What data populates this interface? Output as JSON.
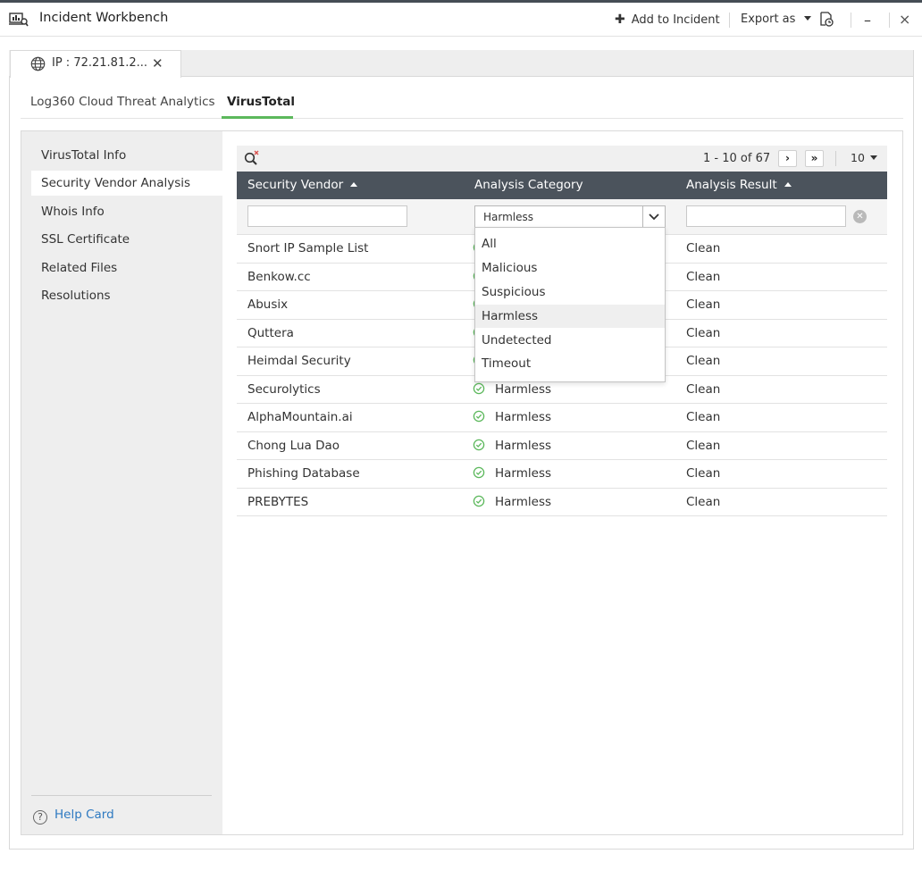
{
  "window": {
    "title": "Incident Workbench",
    "add_to_incident": "Add to Incident",
    "export_as": "Export as"
  },
  "tabs": {
    "ip_tab_label": "IP : 72.21.81.2..."
  },
  "subtabs": [
    "Log360 Cloud Threat Analytics",
    "VirusTotal"
  ],
  "sidebar": {
    "items": [
      "VirusTotal Info",
      "Security Vendor Analysis",
      "Whois Info",
      "SSL Certificate",
      "Related Files",
      "Resolutions"
    ],
    "active": "Security Vendor Analysis",
    "help_label": "Help Card"
  },
  "pagination": {
    "range_text": "1 - 10 of 67",
    "page_size": "10"
  },
  "table": {
    "columns": [
      "Security Vendor",
      "Analysis Category",
      "Analysis Result"
    ],
    "filter": {
      "vendor_value": "",
      "category_value": "Harmless",
      "result_value": ""
    },
    "rows": [
      {
        "vendor": "Snort IP Sample List",
        "category": "Harmless",
        "result": "Clean"
      },
      {
        "vendor": "Benkow.cc",
        "category": "Harmless",
        "result": "Clean"
      },
      {
        "vendor": "Abusix",
        "category": "Harmless",
        "result": "Clean"
      },
      {
        "vendor": "Quttera",
        "category": "Harmless",
        "result": "Clean"
      },
      {
        "vendor": "Heimdal Security",
        "category": "Harmless",
        "result": "Clean"
      },
      {
        "vendor": "Securolytics",
        "category": "Harmless",
        "result": "Clean"
      },
      {
        "vendor": "AlphaMountain.ai",
        "category": "Harmless",
        "result": "Clean"
      },
      {
        "vendor": "Chong Lua Dao",
        "category": "Harmless",
        "result": "Clean"
      },
      {
        "vendor": "Phishing Database",
        "category": "Harmless",
        "result": "Clean"
      },
      {
        "vendor": "PREBYTES",
        "category": "Harmless",
        "result": "Clean"
      }
    ]
  },
  "category_dropdown": {
    "options": [
      "All",
      "Malicious",
      "Suspicious",
      "Harmless",
      "Undetected",
      "Timeout"
    ],
    "selected": "Harmless"
  },
  "colors": {
    "accent_green": "#5cb85c",
    "header_dark": "#4b535c",
    "link_blue": "#2d79c1",
    "harmless_icon": "#5cb85c"
  },
  "icons": {
    "app": "workbench-icon",
    "ip_tab": "globe-icon",
    "search_clear": "search-clear-icon",
    "harmless": "check-circle-icon"
  }
}
